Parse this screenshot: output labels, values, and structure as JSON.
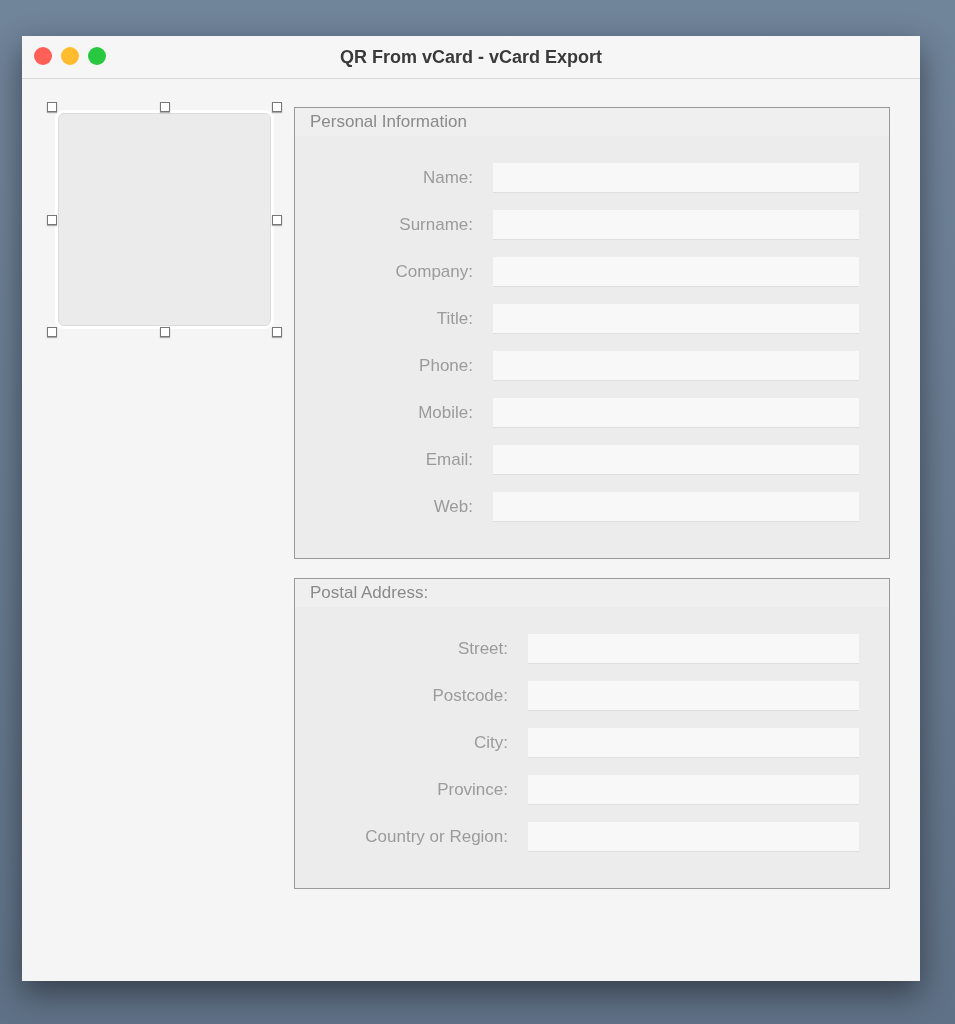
{
  "window": {
    "title": "QR From vCard - vCard Export"
  },
  "image_well": {
    "selected": true
  },
  "groups": [
    {
      "title": "Personal Information",
      "fields": [
        {
          "label": "Name:"
        },
        {
          "label": "Surname:"
        },
        {
          "label": "Company:"
        },
        {
          "label": "Title:"
        },
        {
          "label": "Phone:"
        },
        {
          "label": "Mobile:"
        },
        {
          "label": "Email:"
        },
        {
          "label": "Web:"
        }
      ]
    },
    {
      "title": "Postal Address:",
      "fields": [
        {
          "label": "Street:"
        },
        {
          "label": "Postcode:"
        },
        {
          "label": "City:"
        },
        {
          "label": "Province:"
        },
        {
          "label": "Country or Region:"
        }
      ]
    }
  ]
}
